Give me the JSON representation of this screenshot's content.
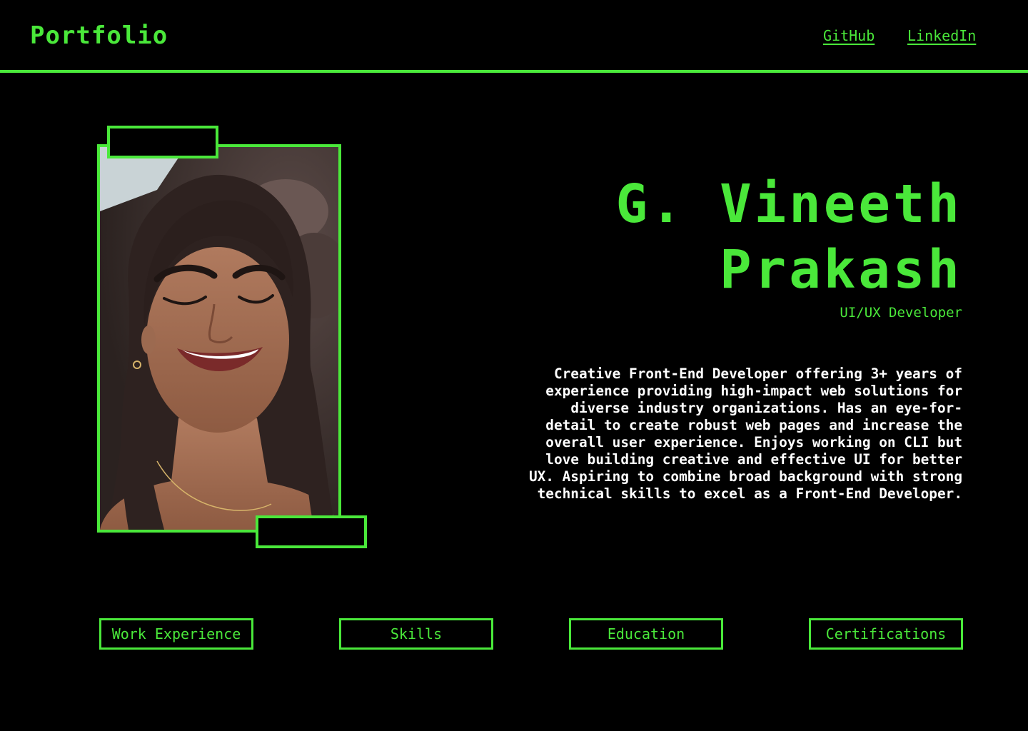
{
  "header": {
    "brand": "Portfolio",
    "links": [
      {
        "label": "GitHub"
      },
      {
        "label": "LinkedIn"
      }
    ]
  },
  "profile": {
    "name_line1": "G. Vineeth",
    "name_line2": "Prakash",
    "role": "UI/UX Developer",
    "bio_lines": [
      "Creative Front-End Developer offering 3+ years of",
      "experience providing high-impact web solutions for",
      "diverse industry organizations. Has an eye-for-",
      "detail to create robust web pages and increase the",
      "overall user experience. Enjoys working on CLI but",
      "love building creative and effective UI for better",
      "UX. Aspiring to combine broad background with strong",
      "technical skills to excel as a Front-End Developer."
    ]
  },
  "sections": [
    {
      "label": "Work Experience"
    },
    {
      "label": "Skills"
    },
    {
      "label": "Education"
    },
    {
      "label": "Certifications"
    }
  ],
  "colors": {
    "accent": "#4ae83a",
    "background": "#000000",
    "body_text": "#ffffff"
  }
}
